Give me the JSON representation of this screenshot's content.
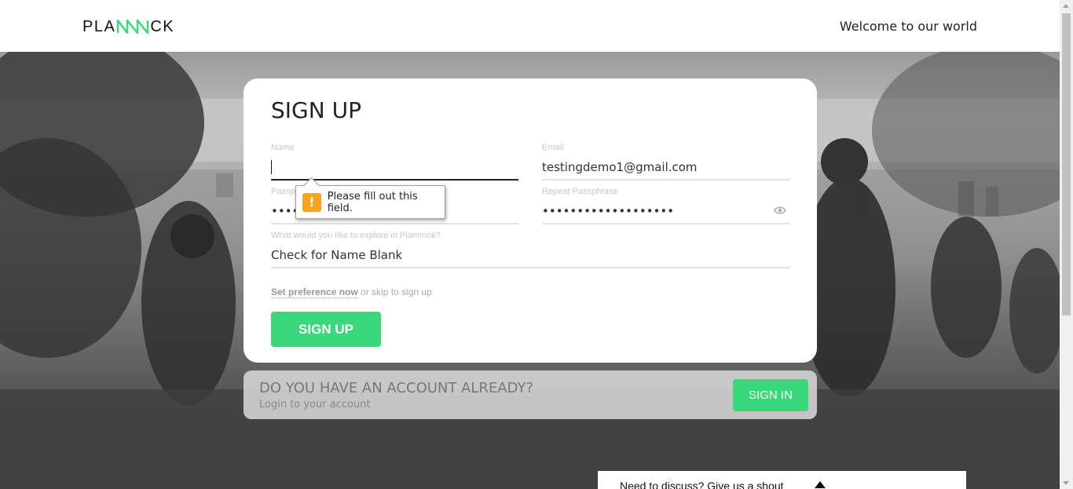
{
  "header": {
    "logo_left": "PLA",
    "logo_right": "CK",
    "welcome": "Welcome to our world"
  },
  "signup": {
    "title": "SIGN UP",
    "name": {
      "label": "Name",
      "value": ""
    },
    "email": {
      "label": "Email",
      "value": "testingdemo1@gmail.com"
    },
    "password": {
      "label": "Passphrase",
      "label_visible": "Passp",
      "value": "••••••"
    },
    "repeat": {
      "label": "Repeat Passphrase",
      "value": "•••••••••••••••••••"
    },
    "explore": {
      "label": "What would you like to explore in Plannnok?",
      "value": "Check for Name Blank"
    },
    "pref_link": "Set preference now",
    "pref_rest": " or skip to sign up",
    "button": "SIGN UP"
  },
  "validation": {
    "message": "Please fill out this field.",
    "icon": "warning-icon"
  },
  "account": {
    "question": "DO YOU HAVE AN ACCOUNT ALREADY?",
    "sub": "Login to your account",
    "button": "SIGN IN"
  },
  "shout": {
    "text": "Need to discuss? Give us a shout"
  },
  "colors": {
    "accent": "#3bd77b",
    "warning": "#f7a31b",
    "logo_green": "#3bd77b"
  }
}
